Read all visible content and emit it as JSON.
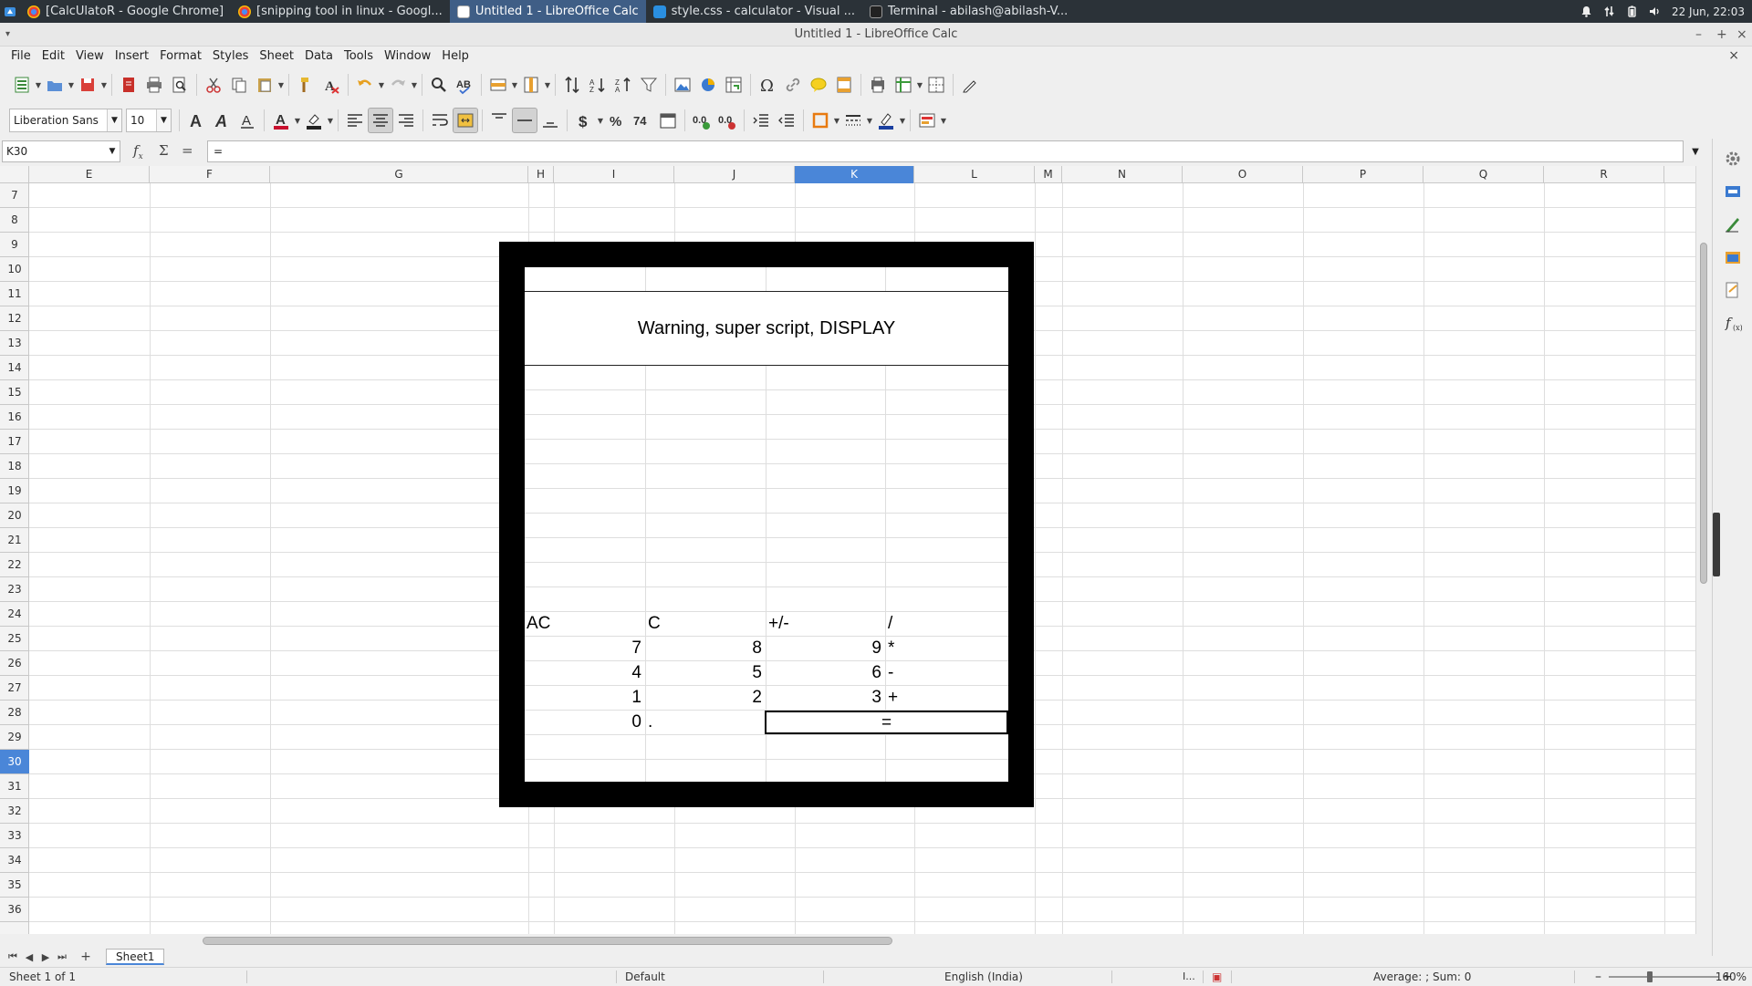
{
  "taskbar": {
    "tasks": [
      {
        "label": "[CalcUlatoR - Google Chrome]",
        "icon": "chrome-icon"
      },
      {
        "label": "[snipping tool in linux - Googl...",
        "icon": "chrome-icon"
      },
      {
        "label": "Untitled 1 - LibreOffice Calc",
        "icon": "calc-icon",
        "active": true
      },
      {
        "label": "style.css - calculator - Visual ...",
        "icon": "vscode-icon"
      },
      {
        "label": "Terminal - abilash@abilash-V...",
        "icon": "terminal-icon"
      }
    ],
    "clock": "22 Jun, 22:03"
  },
  "window": {
    "title": "Untitled 1 - LibreOffice Calc"
  },
  "menu": [
    "File",
    "Edit",
    "View",
    "Insert",
    "Format",
    "Styles",
    "Sheet",
    "Data",
    "Tools",
    "Window",
    "Help"
  ],
  "toolbar": {
    "font_name": "Liberation Sans",
    "font_size": "10"
  },
  "formula_bar": {
    "name_box": "K30",
    "formula": "="
  },
  "columns": [
    "E",
    "F",
    "G",
    "H",
    "I",
    "J",
    "K",
    "L",
    "M",
    "N",
    "O",
    "P",
    "Q",
    "R"
  ],
  "selected_column": "K",
  "rows": [
    "7",
    "8",
    "9",
    "10",
    "11",
    "12",
    "13",
    "14",
    "15",
    "16",
    "17",
    "18",
    "19",
    "20",
    "21",
    "22",
    "23",
    "24",
    "25",
    "26",
    "27",
    "28",
    "29",
    "30",
    "31",
    "32",
    "33",
    "34",
    "35",
    "36"
  ],
  "selected_row": "30",
  "calculator": {
    "display": "Warning, super script, DISPLAY",
    "keys_row26": [
      "AC",
      "C",
      "+/-",
      "/"
    ],
    "keys_row27": [
      "7",
      "8",
      "9",
      "*"
    ],
    "keys_row28": [
      "4",
      "5",
      "6",
      "-"
    ],
    "keys_row29": [
      "1",
      "2",
      "3",
      "+"
    ],
    "keys_row30": [
      "0",
      ".",
      "="
    ]
  },
  "sheet_tab": "Sheet1",
  "status": {
    "sheet": "Sheet 1 of 1",
    "style": "Default",
    "language": "English (India)",
    "summary": "Average: ; Sum: 0",
    "zoom": "160%"
  },
  "colors": {
    "selection": "#4a86d8",
    "taskbar": "#2b3238",
    "calc_border": "#000000"
  }
}
